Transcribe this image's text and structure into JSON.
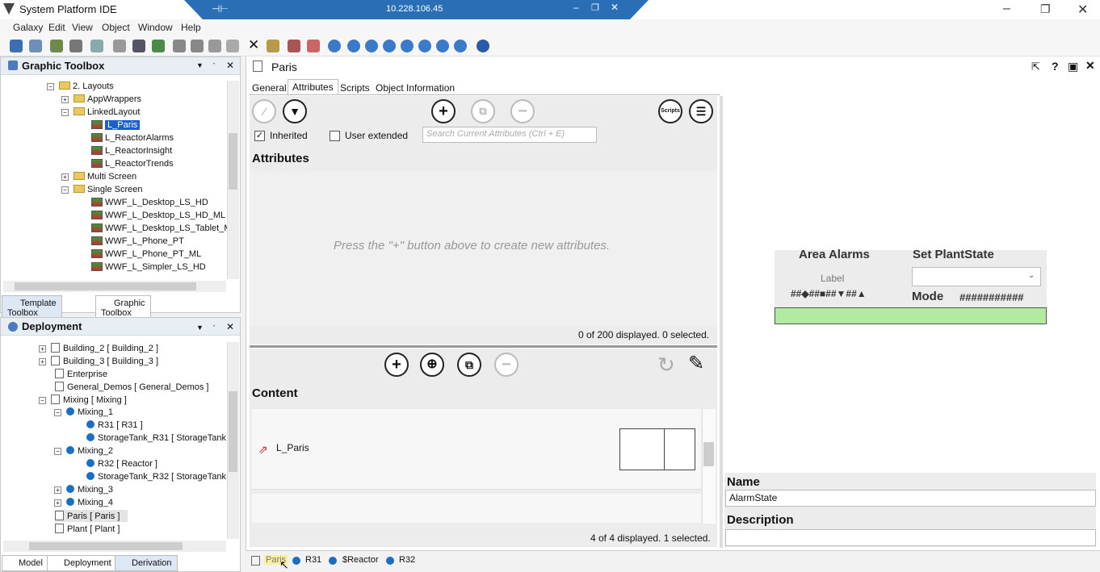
{
  "window": {
    "title": "System Platform IDE",
    "remote_ip": "10.228.106.45"
  },
  "menu": [
    "Galaxy",
    "Edit",
    "View",
    "Object",
    "Window",
    "Help"
  ],
  "graphic_toolbox": {
    "title": "Graphic Toolbox",
    "items": [
      "2. Layouts",
      "AppWrappers",
      "LinkedLayout",
      "L_Paris",
      "L_ReactorAlarms",
      "L_ReactorInsight",
      "L_ReactorTrends",
      "Multi Screen",
      "Single Screen",
      "WWF_L_Desktop_LS_HD",
      "WWF_L_Desktop_LS_HD_ML",
      "WWF_L_Desktop_LS_Tablet_M",
      "WWF_L_Phone_PT",
      "WWF_L_Phone_PT_ML",
      "WWF_L_Simpler_LS_HD"
    ],
    "tabs": [
      "Template Toolbox",
      "Graphic Toolbox"
    ]
  },
  "deployment": {
    "title": "Deployment",
    "items": [
      "Building_2 [ Building_2 ]",
      "Building_3 [ Building_3 ]",
      "Enterprise",
      "General_Demos [ General_Demos ]",
      "Mixing [ Mixing ]",
      "Mixing_1",
      "R31 [ R31 ]",
      "StorageTank_R31 [ StorageTank",
      "Mixing_2",
      "R32 [ Reactor ]",
      "StorageTank_R32 [ StorageTank",
      "Mixing_3",
      "Mixing_4",
      "Paris [ Paris ]",
      "Plant [ Plant ]"
    ],
    "tabs": [
      "Model",
      "Deployment",
      "Derivation"
    ]
  },
  "editor": {
    "title": "Paris",
    "tabs": [
      "General",
      "Attributes",
      "Scripts",
      "Object Information"
    ],
    "inherited": "Inherited",
    "user_extended": "User extended",
    "search_placeholder": "Search Current Attributes (Ctrl + E)",
    "attributes_header": "Attributes",
    "empty_hint": "Press the \"+\" button above to create new attributes.",
    "attr_status": "0 of 200 displayed. 0 selected.",
    "content_header": "Content",
    "content_item": "L_Paris",
    "content_status": "4 of 4 displayed. 1 selected.",
    "scripts_btn": "Scripts"
  },
  "preview": {
    "area_alarms": "Area Alarms",
    "set_plantstate": "Set PlantState",
    "label": "Label",
    "alarm_row": "##◆##■##▼##▲",
    "mode": "Mode",
    "mode_value": "###########"
  },
  "properties": {
    "name_label": "Name",
    "name_value": "AlarmState",
    "desc_label": "Description"
  },
  "breadcrumb": [
    "Paris",
    "R31",
    "$Reactor",
    "R32"
  ]
}
